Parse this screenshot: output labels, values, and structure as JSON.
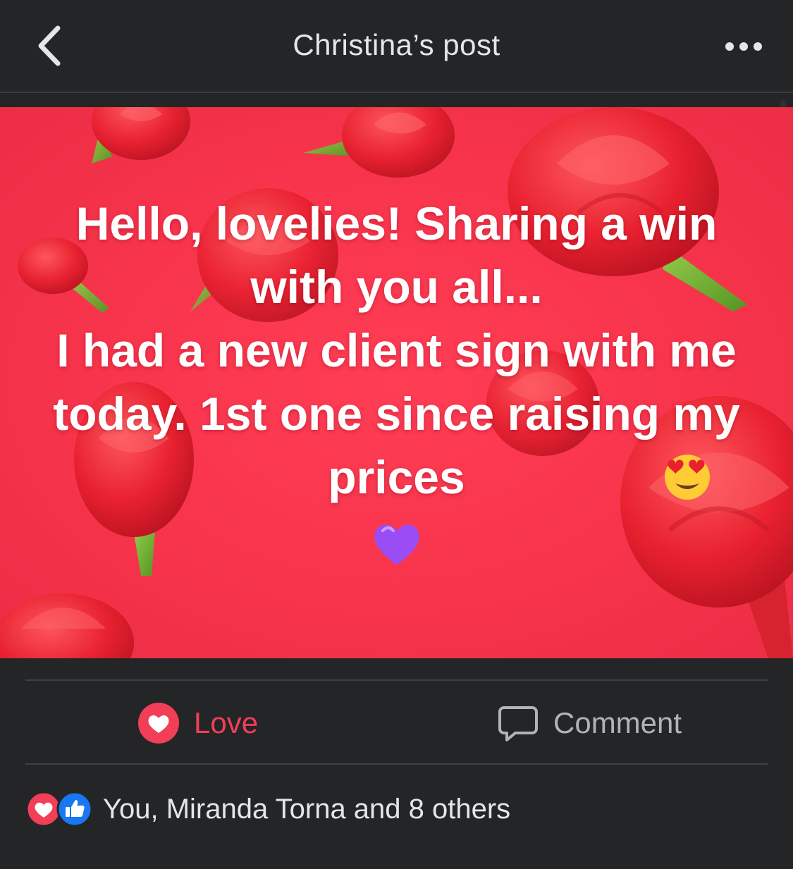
{
  "header": {
    "title": "Christina’s post",
    "back_icon": "chevron-left-icon",
    "more_icon": "more-horizontal-icon"
  },
  "post": {
    "text": "Hello, lovelies! Sharing a win with you all...\nI had a new client sign with me today. 1st one since raising my prices",
    "inline_emoji": "heart-eyes-emoji",
    "trailing_emoji": "purple-heart-emoji",
    "background_color": "#f7344c",
    "decoration": "roses"
  },
  "actions": {
    "love_label": "Love",
    "comment_label": "Comment",
    "love_color": "#f33e58"
  },
  "reactions": {
    "summary": "You, Miranda Torna and 8 others",
    "icons": [
      "love-reaction-icon",
      "like-reaction-icon"
    ]
  }
}
